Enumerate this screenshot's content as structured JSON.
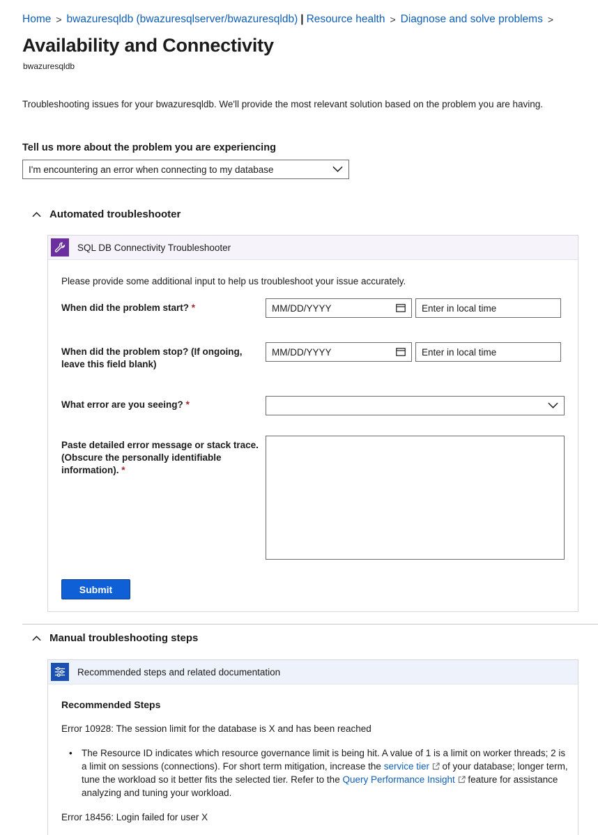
{
  "breadcrumb": {
    "items": [
      "Home",
      "bwazuresqldb (bwazuresqlserver/bwazuresqldb)",
      "Resource health",
      "Diagnose and solve problems"
    ],
    "separator": ">",
    "pipe": "|"
  },
  "page": {
    "title": "Availability and Connectivity",
    "subtitle": "bwazuresqldb",
    "intro": "Troubleshooting issues for your bwazuresqldb. We'll provide the most relevant solution based on the problem you are having."
  },
  "problem": {
    "label": "Tell us more about the problem you are experiencing",
    "selected": "I'm encountering an error when connecting to my database"
  },
  "automated": {
    "heading": "Automated troubleshooter",
    "caret": "^",
    "card_title": "SQL DB Connectivity Troubleshooter",
    "prompt": "Please provide some additional input to help us troubleshoot your issue accurately.",
    "start_label": "When did the problem start?",
    "stop_label": "When did the problem stop? (If ongoing, leave this field blank)",
    "error_label": "What error are you seeing?",
    "details_label": "Paste detailed error message or stack trace. (Obscure the personally identifiable information).",
    "required_mark": "*",
    "date_placeholder": "MM/DD/YYYY",
    "time_placeholder": "Enter in local time",
    "error_selected": "",
    "details_value": "",
    "submit_label": "Submit"
  },
  "manual": {
    "heading": "Manual troubleshooting steps",
    "caret": "^",
    "card_title": "Recommended steps and related documentation",
    "steps_heading": "Recommended Steps",
    "error1": "Error 10928: The session limit for the database is X and has been reached",
    "bullet_part1": "The Resource ID indicates which resource governance limit is being hit. A value of 1 is a limit on worker threads; 2 is a limit on sessions (connections). For short term mitigation, increase the ",
    "link_service_tier": "service tier",
    "bullet_part2": " of your database; longer term, tune the workload so it better fits the selected tier. Refer to the ",
    "link_qpi": "Query Performance Insight",
    "bullet_part3": " feature for assistance analyzing and tuning your workload.",
    "error2": "Error 18456: Login failed for user X"
  },
  "colors": {
    "link": "#0f5fb8",
    "accent_purple": "#6b2fa0",
    "accent_blue": "#1a4fb3",
    "submit": "#0f5fd6"
  },
  "icons": {
    "troubleshooter": "wrench-icon",
    "recommended": "sliders-icon",
    "calendar": "calendar-icon",
    "dropdown": "chevron-down-icon",
    "external": "external-link-icon"
  }
}
